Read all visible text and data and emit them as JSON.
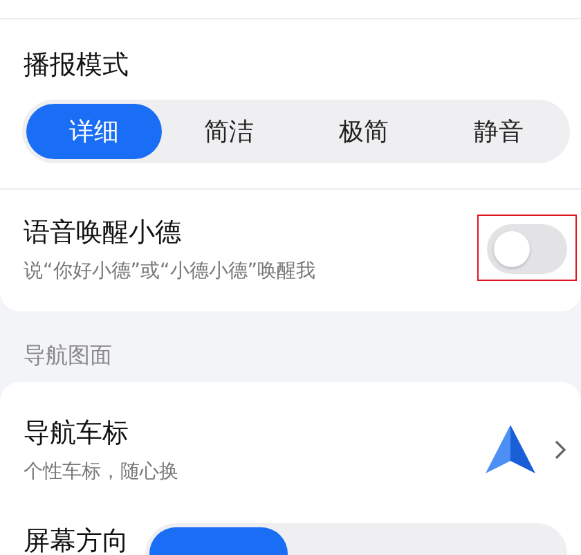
{
  "broadcast_mode": {
    "title": "播报模式",
    "options": [
      {
        "label": "详细",
        "selected": true
      },
      {
        "label": "简洁",
        "selected": false
      },
      {
        "label": "极简",
        "selected": false
      },
      {
        "label": "静音",
        "selected": false
      }
    ]
  },
  "voice_wake": {
    "title": "语音唤醒小德",
    "subtitle": "说“你好小德”或“小德小德”唤醒我",
    "on": false,
    "highlighted": true
  },
  "section_header": "导航图面",
  "car_icon": {
    "title": "导航车标",
    "subtitle": "个性车标，随心换"
  },
  "screen_orientation": {
    "title": "屏幕方向",
    "options": [
      {
        "selected": true
      },
      {
        "selected": false
      },
      {
        "selected": false
      }
    ]
  }
}
